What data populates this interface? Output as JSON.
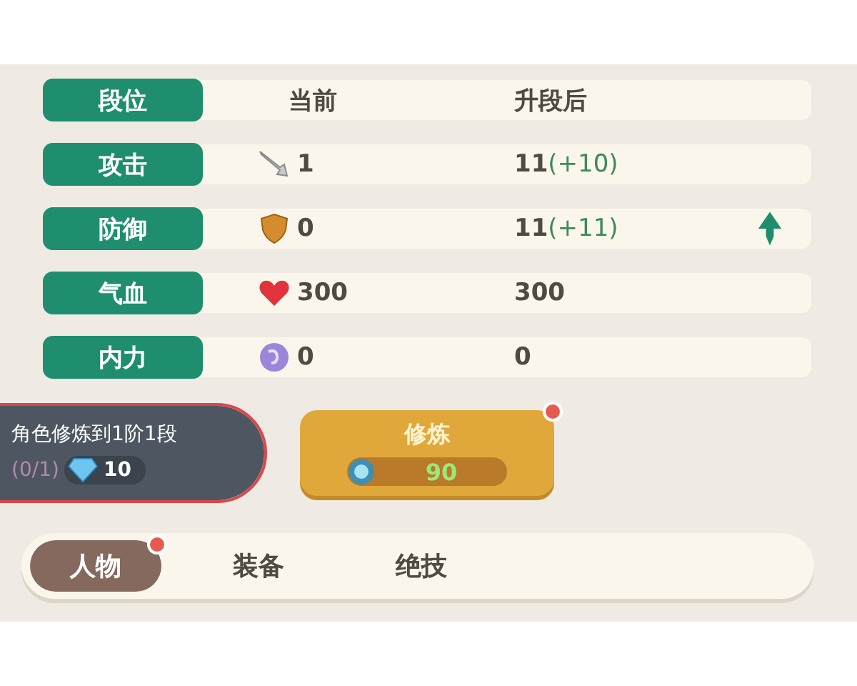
{
  "header": {
    "label": "段位",
    "current": "当前",
    "after": "升段后"
  },
  "stats": [
    {
      "label": "攻击",
      "current": "1",
      "after": "11",
      "bonus": "(+10)",
      "upgrade_arrow": false
    },
    {
      "label": "防御",
      "current": "0",
      "after": "11",
      "bonus": "(+11)",
      "upgrade_arrow": true
    },
    {
      "label": "气血",
      "current": "300",
      "after": "300",
      "upgrade_arrow": false
    },
    {
      "label": "内力",
      "current": "0",
      "after": "0",
      "upgrade_arrow": false
    }
  ],
  "task": {
    "text": "角色修炼到1阶1段",
    "progress": "(0/1)",
    "cost": "10",
    "highlighted": true
  },
  "train_button": {
    "label": "修炼",
    "cost": "90",
    "notification": true
  },
  "tabs": [
    {
      "label": "人物",
      "selected": true,
      "notification": true
    },
    {
      "label": "装备",
      "selected": false,
      "notification": false
    },
    {
      "label": "绝技",
      "selected": false,
      "notification": false
    }
  ]
}
